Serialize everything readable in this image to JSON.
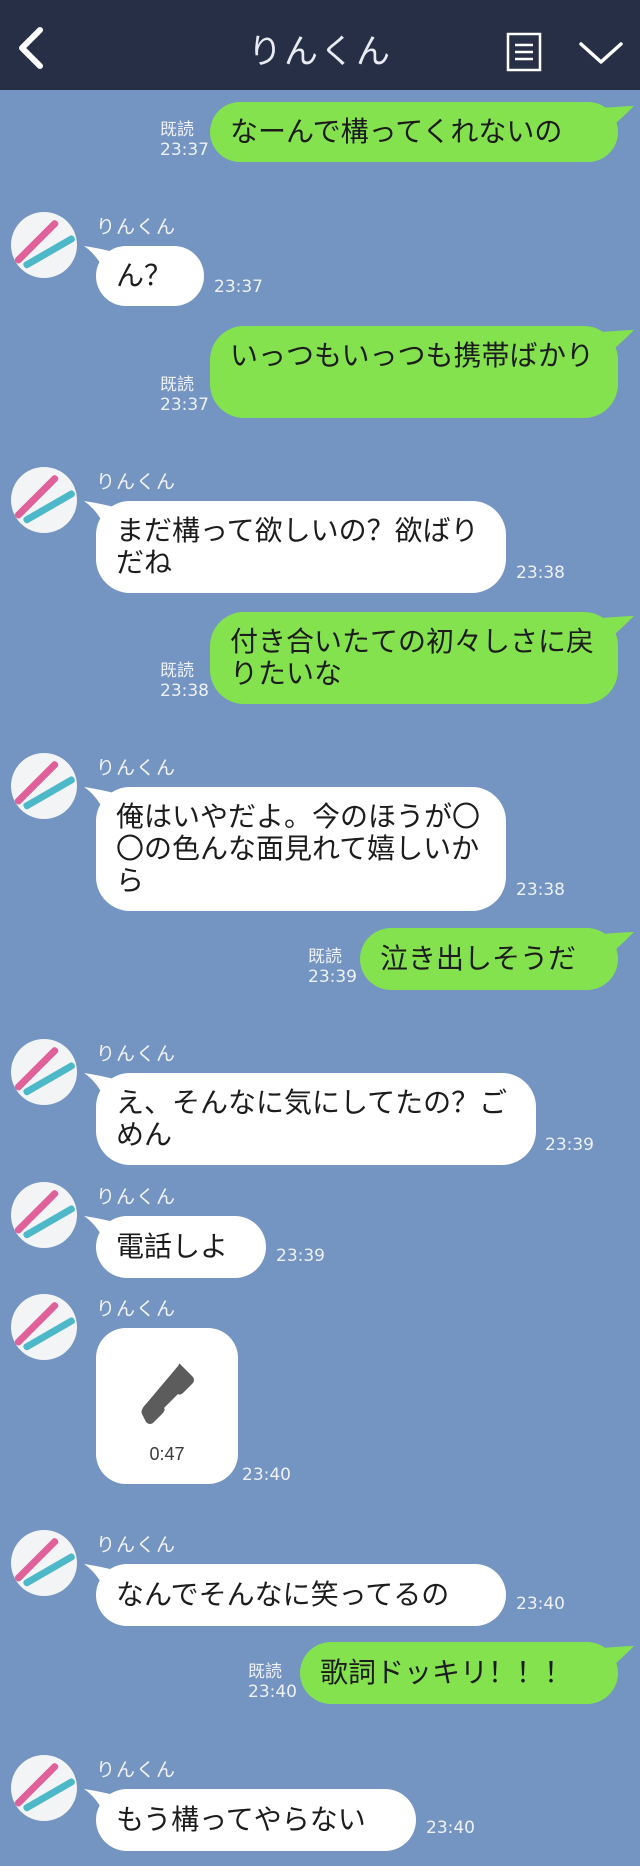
{
  "header": {
    "title": "りんくん"
  },
  "contact": {
    "name": "りんくん"
  },
  "status": {
    "read": "既読"
  },
  "messages": [
    {
      "side": "out",
      "text": "なーんで構ってくれないの",
      "time": "23:37"
    },
    {
      "side": "in",
      "text": "ん？",
      "time": "23:37"
    },
    {
      "side": "out",
      "text": "いっつもいっつも携帯ばかり",
      "time": "23:37"
    },
    {
      "side": "in",
      "text": "まだ構って欲しいの？欲ばりだね",
      "time": "23:38"
    },
    {
      "side": "out",
      "text": "付き合いたての初々しさに戻りたいな",
      "time": "23:38"
    },
    {
      "side": "in",
      "text": "俺はいやだよ。今のほうが〇〇の色んな面見れて嬉しいから",
      "time": "23:38"
    },
    {
      "side": "out",
      "text": "泣き出しそうだ",
      "time": "23:39"
    },
    {
      "side": "in",
      "text": "え、そんなに気にしてたの？ごめん",
      "time": "23:39"
    },
    {
      "side": "in",
      "text": "電話しよ",
      "time": "23:39"
    },
    {
      "side": "in",
      "call_duration": "0:47",
      "time": "23:40"
    },
    {
      "side": "in",
      "text": "なんでそんなに笑ってるの",
      "time": "23:40"
    },
    {
      "side": "out",
      "text": "歌詞ドッキリ！！！",
      "time": "23:40"
    },
    {
      "side": "in",
      "text": "もう構ってやらない",
      "time": "23:40"
    }
  ]
}
